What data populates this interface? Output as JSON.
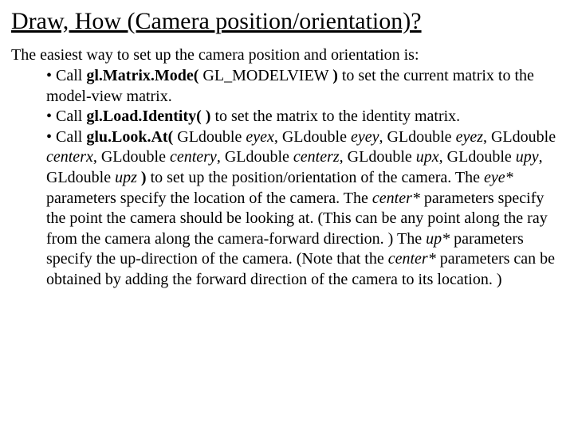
{
  "title": "Draw, How (Camera position/orientation)?",
  "intro": "The easiest way to set up the camera position and orientation is:",
  "b1a": "• Call ",
  "b1fn": "gl.Matrix.Mode(",
  "b1arg": " GL_MODELVIEW ",
  "b1close": ")",
  "b1b": " to set the current matrix to the model-view matrix.",
  "b2a": "• Call ",
  "b2fn": "gl.Load.Identity( )",
  "b2b": " to set the matrix to the identity matrix.",
  "b3a": "• Call ",
  "b3fn": "glu.Look.At(",
  "gld": "GLdouble ",
  "eyex": "eyex",
  "eyey": "eyey",
  "eyez": "eyez",
  "centerx": "centerx",
  "centery": "centery",
  "centerz": "centerz",
  "upx": "upx",
  "upy": "upy",
  "upz": "upz",
  "comma": ", ",
  "closep": " )",
  "b3b1": " to set up the position/orientation of the camera. The ",
  "eye_star": "eye*",
  "b3b2": " parameters specify the location of the camera. The ",
  "center_star": "center*",
  "b3b3": " parameters specify the point the camera should be looking at. (This can be any point along the ray from the camera along the camera-forward direction. ) The ",
  "up_star": "up*",
  "b3b4": " parameters specify the up-direction of the camera. (Note that the ",
  "b3b5": " parameters can be obtained by adding the forward direction of the camera to its location. )"
}
